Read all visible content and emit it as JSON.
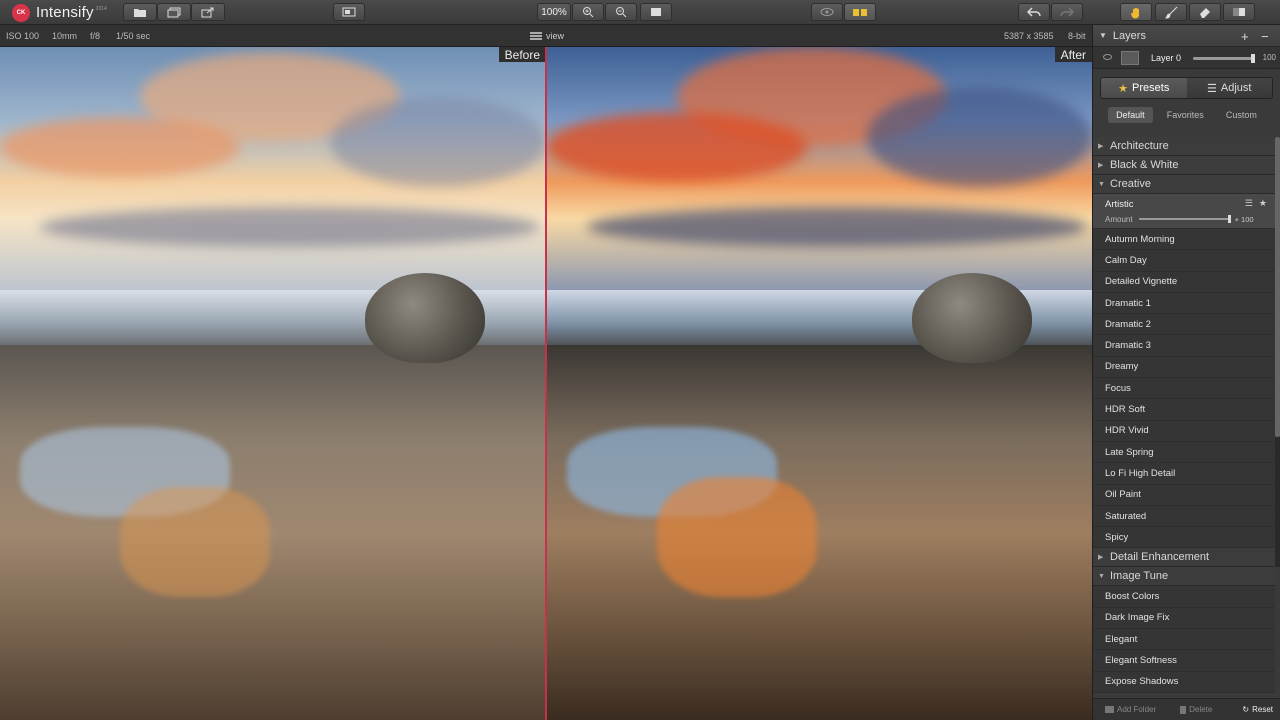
{
  "app": {
    "logo_badge": "CK",
    "title": "Intensify",
    "edition": "2014",
    "zoom_label": "100%"
  },
  "info": {
    "iso": "ISO 100",
    "focal": "10mm",
    "aperture": "f/8",
    "shutter": "1/50 sec",
    "view_label": "view",
    "dimensions": "5387 x 3585",
    "bit_depth": "8-bit"
  },
  "photo": {
    "before_label": "Before",
    "after_label": "After"
  },
  "layers": {
    "title": "Layers",
    "layer_name": "Layer 0",
    "opacity": "100",
    "opacity_fraction": 1.0
  },
  "tabs": {
    "presets": "Presets",
    "adjust": "Adjust",
    "sub": [
      "Default",
      "Favorites",
      "Custom"
    ]
  },
  "presets": {
    "cat_architecture": "Architecture",
    "cat_bw": "Black & White",
    "cat_creative": "Creative",
    "selected_name": "Artistic",
    "amount_label": "Amount",
    "amount_value": "+ 100",
    "amount_fraction": 1.0,
    "creative_items": [
      "Autumn Morning",
      "Calm Day",
      "Detailed Vignette",
      "Dramatic 1",
      "Dramatic 2",
      "Dramatic 3",
      "Dreamy",
      "Focus",
      "HDR Soft",
      "HDR Vivid",
      "Late Spring",
      "Lo Fi High Detail",
      "Oil Paint",
      "Saturated",
      "Spicy"
    ],
    "cat_detail": "Detail Enhancement",
    "cat_tune": "Image Tune",
    "tune_items": [
      "Boost Colors",
      "Dark Image Fix",
      "Elegant",
      "Elegant Softness",
      "Expose Shadows"
    ]
  },
  "footer": {
    "add_folder": "Add Folder",
    "delete": "Delete",
    "reset": "Reset"
  },
  "colors": {
    "accent": "#c8314a",
    "toolbar": "#404040",
    "panel": "#3a3a3a"
  }
}
